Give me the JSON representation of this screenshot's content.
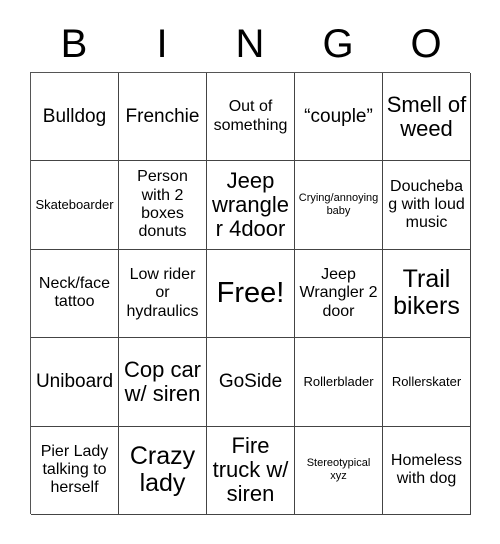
{
  "card": {
    "title_letters": [
      "B",
      "I",
      "N",
      "G",
      "O"
    ],
    "columns": 5,
    "rows": 5,
    "border_color": "#444444",
    "background_color": "#ffffff",
    "text_color": "#000000",
    "free_space": "Free!",
    "free_space_position": {
      "row": 3,
      "column": 3
    }
  },
  "cells": [
    [
      {
        "text": "Bulldog",
        "size": "fs-l"
      },
      {
        "text": "Frenchie",
        "size": "fs-l"
      },
      {
        "text": "Out of something",
        "size": "fs-m"
      },
      {
        "text": "“couple”",
        "size": "fs-l"
      },
      {
        "text": "Smell of weed",
        "size": "fs-xl"
      }
    ],
    [
      {
        "text": "Skateboarder",
        "size": "fs-s"
      },
      {
        "text": "Person with 2 boxes donuts",
        "size": "fs-m"
      },
      {
        "text": "Jeep wrangler 4door",
        "size": "fs-xl"
      },
      {
        "text": "Crying/annoying baby",
        "size": "fs-xs"
      },
      {
        "text": "Douchebag with loud music",
        "size": "fs-m"
      }
    ],
    [
      {
        "text": "Neck/face tattoo",
        "size": "fs-m"
      },
      {
        "text": "Low rider or hydraulics",
        "size": "fs-m"
      },
      {
        "text": "Free!",
        "size": "fs-h"
      },
      {
        "text": "Jeep Wrangler 2 door",
        "size": "fs-m"
      },
      {
        "text": "Trail bikers",
        "size": "fs-xxl"
      }
    ],
    [
      {
        "text": "Uniboard",
        "size": "fs-l"
      },
      {
        "text": "Cop car w/ siren",
        "size": "fs-xl"
      },
      {
        "text": "GoSide",
        "size": "fs-l"
      },
      {
        "text": "Rollerblader",
        "size": "fs-s"
      },
      {
        "text": "Rollerskater",
        "size": "fs-s"
      }
    ],
    [
      {
        "text": "Pier Lady talking to herself",
        "size": "fs-m"
      },
      {
        "text": "Crazy lady",
        "size": "fs-xxl"
      },
      {
        "text": "Fire truck w/ siren",
        "size": "fs-xl"
      },
      {
        "text": "Stereotypical xyz",
        "size": "fs-xs"
      },
      {
        "text": "Homeless with dog",
        "size": "fs-m"
      }
    ]
  ]
}
